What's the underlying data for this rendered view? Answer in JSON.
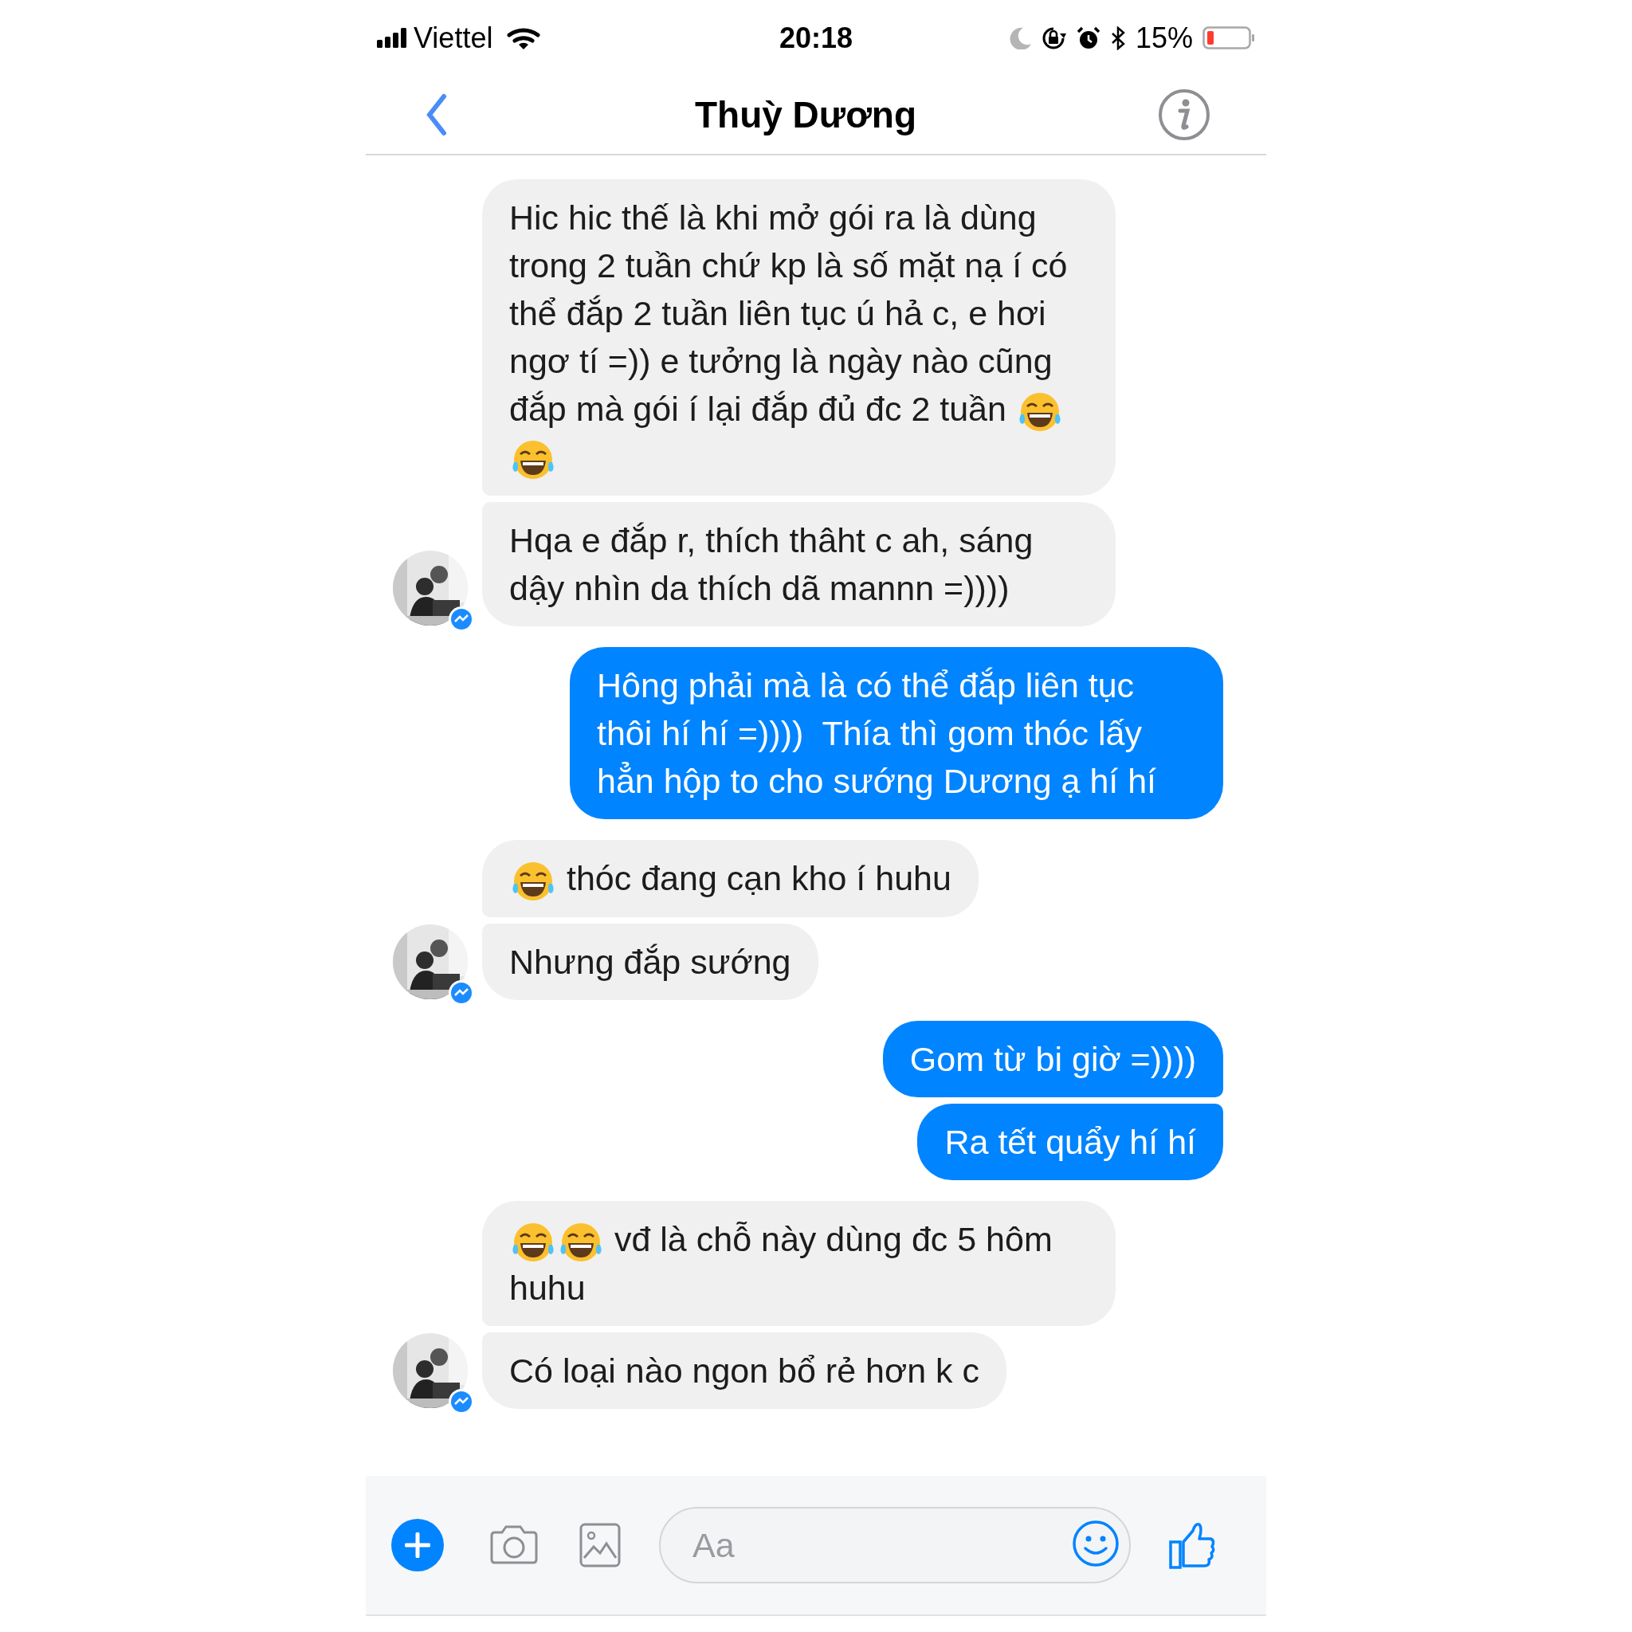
{
  "status_bar": {
    "carrier": "Viettel",
    "time": "20:18",
    "battery": "15%"
  },
  "header": {
    "title": "Thuỳ Dương"
  },
  "messages": [
    {
      "kind": "incoming",
      "avatar": false,
      "parts": [
        {
          "kind": "text",
          "text": "Hic hic thế là khi mở gói ra là dùng trong 2 tuần chứ kp là số mặt nạ í có thể đắp 2 tuần liên tục ú hả c, e hơi ngơ tí =)) e tưởng là ngày nào cũng đắp mà gói í lại đắp đủ đc 2 tuần"
        },
        {
          "kind": "emoji"
        },
        {
          "kind": "break"
        },
        {
          "kind": "emoji"
        }
      ]
    },
    {
      "kind": "incoming",
      "avatar": true,
      "parts": [
        {
          "kind": "text",
          "text": "Hqa e đắp r, thích thâht c ah, sáng dậy nhìn da thích dã mannn =))))"
        }
      ]
    },
    {
      "kind": "outgoing",
      "parts": [
        {
          "kind": "text",
          "text": "Hông phải mà là có thể đắp liên tục thôi hí hí =))))  Thía thì gom thóc lấy hẳn hộp to cho sướng Dương ạ hí hí"
        }
      ]
    },
    {
      "kind": "incoming",
      "avatar": false,
      "parts": [
        {
          "kind": "emoji"
        },
        {
          "kind": "text",
          "text": "thóc đang cạn kho í huhu"
        }
      ]
    },
    {
      "kind": "incoming",
      "avatar": true,
      "parts": [
        {
          "kind": "text",
          "text": "Nhưng đắp sướng"
        }
      ]
    },
    {
      "kind": "outgoing",
      "parts": [
        {
          "kind": "text",
          "text": "Gom từ bi giờ =))))"
        }
      ]
    },
    {
      "kind": "outgoing",
      "parts": [
        {
          "kind": "text",
          "text": "Ra tết quẩy hí hí"
        }
      ]
    },
    {
      "kind": "incoming",
      "avatar": false,
      "parts": [
        {
          "kind": "emoji"
        },
        {
          "kind": "emoji"
        },
        {
          "kind": "text",
          "text": "vđ là chỗ này dùng đc 5 hôm huhu"
        }
      ]
    },
    {
      "kind": "incoming",
      "avatar": true,
      "parts": [
        {
          "kind": "text",
          "text": "Có loại nào ngon bổ rẻ hơn k c"
        }
      ]
    }
  ],
  "composer": {
    "placeholder": "Aa"
  }
}
